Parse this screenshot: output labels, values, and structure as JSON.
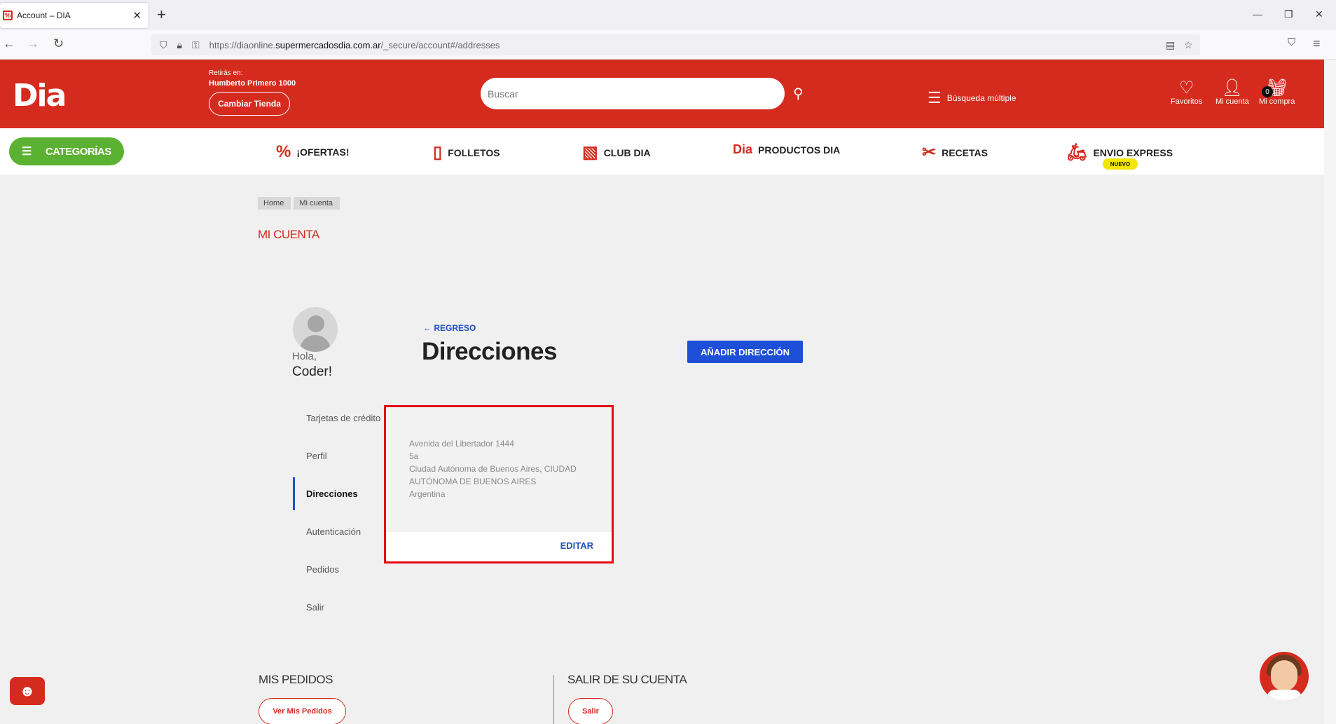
{
  "browser": {
    "tab_title": "Account – DIA",
    "url_prefix": "https://diaonline.",
    "url_domain": "supermercadosdia.com.ar",
    "url_path": "/_secure/account#/addresses"
  },
  "header": {
    "logo": "Dia",
    "store_label": "Retirás en:",
    "store_name": "Humberto Primero 1000",
    "change_store": "Cambiar Tienda",
    "search_placeholder": "Buscar",
    "multi_search": "Búsqueda múltiple",
    "favorites": "Favoritos",
    "account": "Mi cuenta",
    "cart": "Mi compra",
    "cart_count": "0"
  },
  "nav": {
    "categories": "CATEGORÍAS",
    "items": [
      "¡OFERTAS!",
      "FOLLETOS",
      "CLUB DIA",
      "PRODUCTOS DIA",
      "RECETAS",
      "ENVIO EXPRESS"
    ],
    "dia_logo": "Dia",
    "new_badge": "NUEVO"
  },
  "breadcrumb": [
    "Home",
    "Mi cuenta"
  ],
  "page_section": "MI CUENTA",
  "profile": {
    "greeting": "Hola,",
    "name": "Coder!"
  },
  "menu": [
    "Tarjetas de crédito",
    "Perfil",
    "Direcciones",
    "Autenticación",
    "Pedidos",
    "Salir"
  ],
  "main": {
    "back": "REGRESO",
    "title": "Direcciones",
    "add_button": "AÑADIR DIRECCIÓN"
  },
  "address": {
    "lines": [
      "Avenida del Libertador 1444",
      "5a",
      "Ciudad Autónoma de Buenos Aires, CIUDAD",
      "AUTÓNOMA DE BUENOS AIRES",
      "Argentina"
    ],
    "edit": "EDITAR"
  },
  "footer": {
    "orders_title": "MIS PEDIDOS",
    "orders_button": "Ver Mis Pedidos",
    "logout_title": "SALIR DE SU CUENTA",
    "logout_button": "Salir"
  },
  "colors": {
    "brand_red": "#d52b1e",
    "link_blue": "#2350c8",
    "green": "#5bb131",
    "highlight": "#e10c14"
  }
}
